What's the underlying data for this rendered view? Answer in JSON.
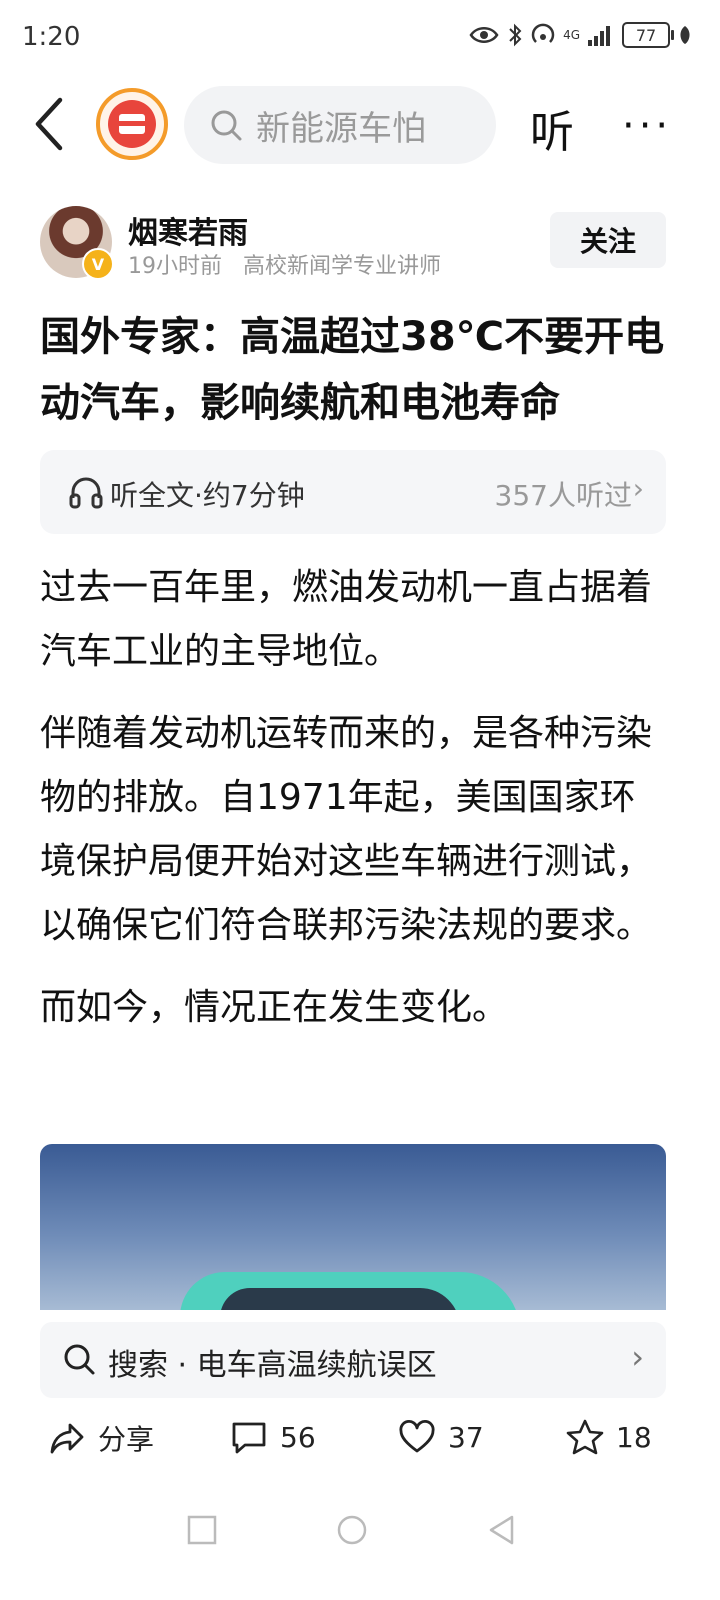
{
  "status_bar": {
    "time": "1:20",
    "network": "4G",
    "battery": "77"
  },
  "top_bar": {
    "search_text": "新能源车怕",
    "listen_label": "听",
    "more_label": "···"
  },
  "author": {
    "name": "烟寒若雨",
    "time": "19小时前",
    "title": "高校新闻学专业讲师",
    "follow_label": "关注",
    "verified_mark": "V"
  },
  "article": {
    "title": "国外专家：高温超过38℃不要开电动汽车，影响续航和电池寿命",
    "listen": {
      "label": "听全文·约7分钟",
      "count": "357人听过"
    },
    "paragraphs": [
      "过去一百年里，燃油发动机一直占据着汽车工业的主导地位。",
      "伴随着发动机运转而来的，是各种污染物的排放。自1971年起，美国国家环境保护局便开始对这些车辆进行测试，以确保它们符合联邦污染法规的要求。",
      "而如今，情况正在发生变化。"
    ]
  },
  "related_search": {
    "label": "搜索 · 电车高温续航误区"
  },
  "actions": {
    "share": "分享",
    "comments": "56",
    "likes": "37",
    "favorites": "18"
  },
  "icons": {
    "back": "chevron-left-icon",
    "search": "search-icon",
    "headphones": "headphones-icon",
    "share": "share-icon",
    "comment": "comment-icon",
    "like": "heart-icon",
    "favorite": "star-icon"
  },
  "colors": {
    "logo_ring": "#f49b2a",
    "logo_red": "#e8453c",
    "verified": "#f5b21a"
  }
}
